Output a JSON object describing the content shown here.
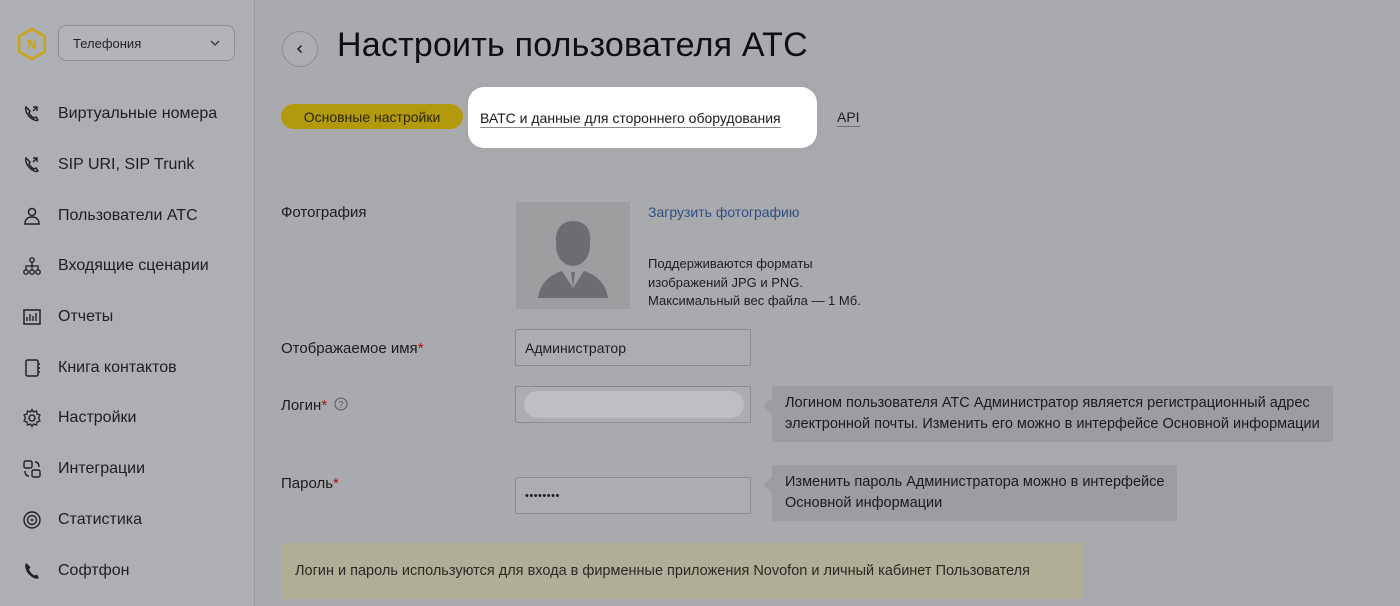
{
  "sidebar": {
    "selector_label": "Телефония",
    "items": [
      {
        "label": "Виртуальные номера",
        "icon": "phone-forward-icon"
      },
      {
        "label": "SIP URI, SIP Trunk",
        "icon": "phone-forward-icon"
      },
      {
        "label": "Пользователи АТС",
        "icon": "user-icon"
      },
      {
        "label": "Входящие сценарии",
        "icon": "scenario-tree-icon"
      },
      {
        "label": "Отчеты",
        "icon": "report-chart-icon"
      },
      {
        "label": "Книга контактов",
        "icon": "contact-book-icon"
      },
      {
        "label": "Настройки",
        "icon": "gear-icon"
      },
      {
        "label": "Интеграции",
        "icon": "integration-icon"
      },
      {
        "label": "Статистика",
        "icon": "statistics-icon"
      },
      {
        "label": "Софтфон",
        "icon": "phone-icon"
      }
    ]
  },
  "header": {
    "title": "Настроить пользователя АТС"
  },
  "tabs": [
    {
      "label": "Основные настройки",
      "active": true
    },
    {
      "label": "ВАТС и данные для стороннего оборудования",
      "active": false,
      "highlighted": true
    },
    {
      "label": "API",
      "active": false
    }
  ],
  "form": {
    "photo_label": "Фотография",
    "upload_link": "Загрузить фотографию",
    "photo_hint_1": "Поддерживаются форматы",
    "photo_hint_2": "изображений JPG и PNG.",
    "photo_hint_3": "Максимальный вес файла — 1 Мб.",
    "display_name_label": "Отображаемое имя",
    "display_name_value": "Администратор",
    "login_label": "Логин",
    "login_tooltip_1": "Логином пользователя АТС Администратор является регистрационный адрес",
    "login_tooltip_2": "электронной почты. Изменить его можно в интерфейсе Основной информации",
    "password_label": "Пароль",
    "password_value": "••••••••",
    "password_tooltip_1": "Изменить пароль Администратора можно в интерфейсе",
    "password_tooltip_2": "Основной информации",
    "required_mark": "*",
    "info_note": "Логин и пароль используются для входа в фирменные приложения Novofon и личный кабинет Пользователя"
  },
  "colors": {
    "accent": "#b39a0c",
    "required": "#9b1414",
    "link": "#2f4f86",
    "logo": "#c9a514"
  }
}
